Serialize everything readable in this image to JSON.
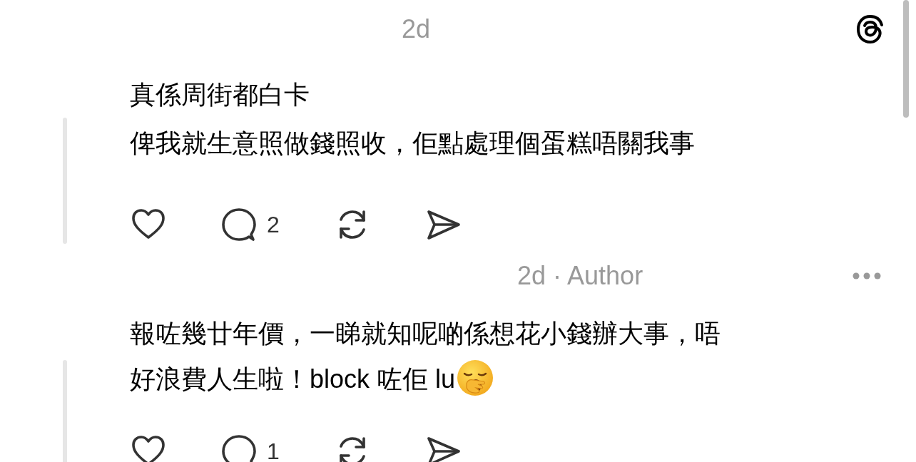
{
  "comments": [
    {
      "meta": "2d",
      "logo": true,
      "more": false,
      "lines": [
        "真係周街都白卡",
        "俾我就生意照做錢照收，佢點處理個蛋糕唔關我事"
      ],
      "emoji": false,
      "replies": "2"
    },
    {
      "meta": "2d · Author",
      "logo": false,
      "more": true,
      "lines": [
        "報咗幾廿年價，一睇就知呢啲係想花小錢辦大事，唔",
        "好浪費人生啦！block 咗佢 lu"
      ],
      "emoji": true,
      "replies": "1"
    }
  ]
}
